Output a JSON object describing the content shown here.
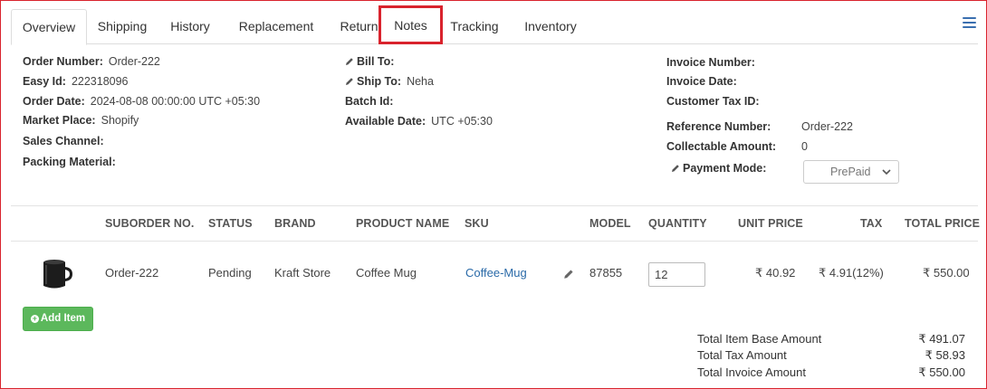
{
  "tabs": [
    {
      "label": "Overview"
    },
    {
      "label": "Shipping"
    },
    {
      "label": "History"
    },
    {
      "label": "Replacement"
    },
    {
      "label": "Return"
    },
    {
      "label": "Notes"
    },
    {
      "label": "Tracking"
    },
    {
      "label": "Inventory"
    }
  ],
  "order": {
    "order_number_label": "Order Number:",
    "order_number": "Order-222",
    "easy_id_label": "Easy Id:",
    "easy_id": "222318096",
    "order_date_label": "Order Date:",
    "order_date": "2024-08-08 00:00:00 UTC +05:30",
    "market_place_label": "Market Place:",
    "market_place": "Shopify",
    "sales_channel_label": "Sales Channel:",
    "packing_material_label": "Packing Material:"
  },
  "address": {
    "bill_to_label": "Bill To:",
    "ship_to_label": "Ship To:",
    "ship_to": "Neha",
    "batch_id_label": "Batch Id:",
    "available_date_label": "Available Date:",
    "available_date": "UTC +05:30"
  },
  "invoice": {
    "invoice_number_label": "Invoice Number:",
    "invoice_date_label": "Invoice Date:",
    "customer_tax_label": "Customer Tax ID:",
    "reference_number_label": "Reference Number:",
    "reference_number": "Order-222",
    "collectable_label": "Collectable Amount:",
    "collectable": "0",
    "payment_mode_label": "Payment Mode:",
    "payment_mode": "PrePaid"
  },
  "table": {
    "headers": {
      "suborder": "SUBORDER NO.",
      "status": "STATUS",
      "brand": "BRAND",
      "product": "PRODUCT NAME",
      "sku": "SKU",
      "model": "MODEL",
      "quantity": "QUANTITY",
      "unit_price": "UNIT PRICE",
      "tax": "TAX",
      "total_price": "TOTAL PRICE"
    },
    "row": {
      "suborder": "Order-222",
      "status": "Pending",
      "brand": "Kraft Store",
      "product": "Coffee Mug",
      "sku": "Coffee-Mug",
      "model": "87855",
      "quantity": "12",
      "unit_price": "₹ 40.92",
      "tax": "₹ 4.91(12%)",
      "total_price": "₹ 550.00"
    }
  },
  "add_item_label": "Add Item",
  "totals": {
    "base_label": "Total Item Base Amount",
    "base": "₹ 491.07",
    "tax_label": "Total Tax Amount",
    "tax": "₹ 58.93",
    "invoice_label": "Total Invoice Amount",
    "invoice": "₹ 550.00"
  },
  "colors": {
    "highlight": "#d9232d",
    "link": "#2a6aa8",
    "button_green": "#5cb85c",
    "menu_blue": "#3a6fb0"
  },
  "icons": [
    "hamburger-menu-icon",
    "pencil-icon",
    "plus-circle-icon",
    "chevron-down-icon",
    "coffee-mug-image"
  ]
}
